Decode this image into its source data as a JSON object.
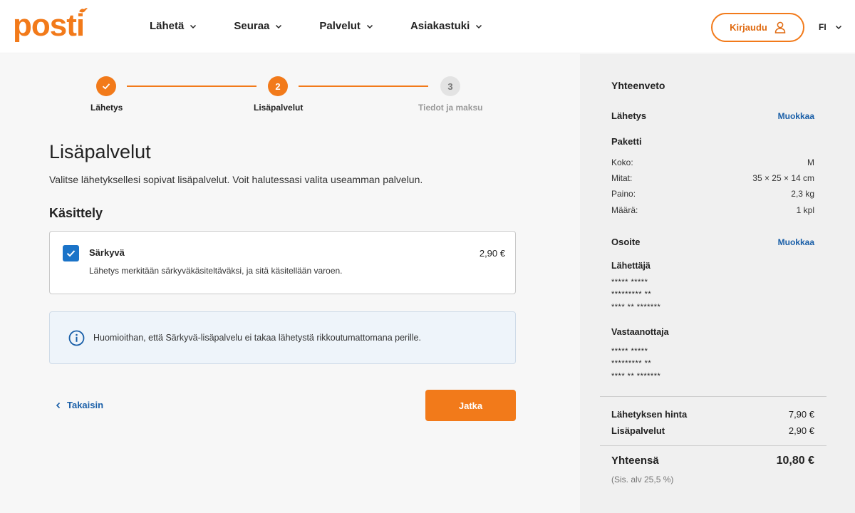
{
  "brand": {
    "logo_text": "posti",
    "accent_color": "#f27a1a",
    "link_color": "#1a5fa8"
  },
  "nav": {
    "items": [
      {
        "label": "Lähetä"
      },
      {
        "label": "Seuraa"
      },
      {
        "label": "Palvelut"
      },
      {
        "label": "Asiakastuki"
      }
    ],
    "login_label": "Kirjaudu",
    "language": "FI"
  },
  "stepper": {
    "steps": [
      {
        "label": "Lähetys",
        "state": "done",
        "marker": "✓"
      },
      {
        "label": "Lisäpalvelut",
        "state": "active",
        "marker": "2"
      },
      {
        "label": "Tiedot ja maksu",
        "state": "pending",
        "marker": "3"
      }
    ]
  },
  "main": {
    "title": "Lisäpalvelut",
    "description": "Valitse lähetyksellesi sopivat lisäpalvelut. Voit halutessasi valita useamman palvelun.",
    "section_title": "Käsittely",
    "service": {
      "name": "Särkyvä",
      "description": "Lähetys merkitään särkyväkäsiteltäväksi, ja sitä käsitellään varoen.",
      "price": "2,90 €",
      "checked": true
    },
    "info": "Huomioithan, että Särkyvä-lisäpalvelu ei takaa lähetystä rikkoutumattomana perille.",
    "back_label": "Takaisin",
    "next_label": "Jatka"
  },
  "summary": {
    "title": "Yhteenveto",
    "shipment_heading": "Lähetys",
    "edit_label": "Muokkaa",
    "package_heading": "Paketti",
    "package_rows": [
      {
        "label": "Koko:",
        "value": "M"
      },
      {
        "label": "Mitat:",
        "value": "35 × 25 × 14 cm"
      },
      {
        "label": "Paino:",
        "value": "2,3 kg"
      },
      {
        "label": "Määrä:",
        "value": "1 kpl"
      }
    ],
    "address_heading": "Osoite",
    "sender_heading": "Lähettäjä",
    "sender_lines": [
      "***** *****",
      "********* **",
      "**** ** *******"
    ],
    "recipient_heading": "Vastaanottaja",
    "recipient_lines": [
      "***** *****",
      "********* **",
      "**** ** *******"
    ],
    "shipping_price_label": "Lähetyksen hinta",
    "shipping_price": "7,90 €",
    "extras_label": "Lisäpalvelut",
    "extras_price": "2,90 €",
    "total_label": "Yhteensä",
    "total_value": "10,80 €",
    "vat_note": "(Sis. alv 25,5 %)"
  }
}
